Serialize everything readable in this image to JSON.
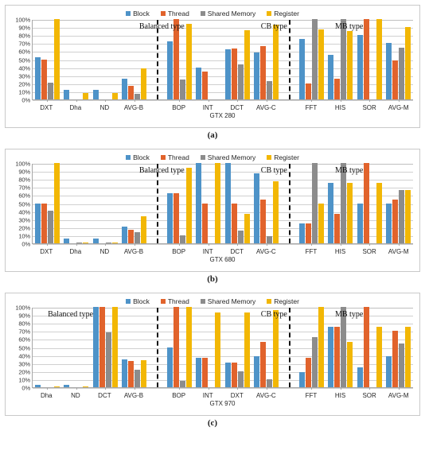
{
  "figure": {
    "panels": [
      {
        "caption": "(a)",
        "axis_title": "GTX 280",
        "zone_labels": [
          "Balanced type",
          "CB type",
          "MB type"
        ]
      },
      {
        "caption": "(b)",
        "axis_title": "GTX 680",
        "zone_labels": [
          "Balanced type",
          "CB type",
          "MB type"
        ]
      },
      {
        "caption": "(c)",
        "axis_title": "GTX 970",
        "zone_labels": [
          "Balanced type",
          "CB type",
          "MB type"
        ]
      }
    ],
    "legend": [
      {
        "label": "Block",
        "color": "#4E93C8"
      },
      {
        "label": "Thread",
        "color": "#E1632C"
      },
      {
        "label": "Shared Memory",
        "color": "#8C8C8C"
      },
      {
        "label": "Register",
        "color": "#F2B705"
      }
    ],
    "y_ticks": [
      "100%",
      "90%",
      "80%",
      "70%",
      "60%",
      "50%",
      "40%",
      "30%",
      "20%",
      "10%",
      "0%"
    ]
  },
  "chart_data": [
    {
      "type": "bar",
      "title": "GTX 280",
      "xlabel": "GTX 280",
      "ylabel": "",
      "ylim": [
        0,
        100
      ],
      "grid": true,
      "legend_position": "top-center",
      "annotations": [
        "Balanced type",
        "CB type",
        "MB type"
      ],
      "categories": [
        "DXT",
        "Dha",
        "ND",
        "AVG-B",
        "BOP",
        "INT",
        "DCT",
        "AVG-C",
        "FFT",
        "HIS",
        "SOR",
        "AVG-M"
      ],
      "series": [
        {
          "name": "Block",
          "values": [
            52,
            12,
            12,
            26,
            72,
            40,
            62,
            58,
            75,
            55,
            80,
            70
          ]
        },
        {
          "name": "Thread",
          "values": [
            50,
            0,
            0,
            17,
            100,
            35,
            63,
            66,
            20,
            26,
            100,
            49
          ]
        },
        {
          "name": "Shared Memory",
          "values": [
            21,
            0,
            0,
            7,
            25,
            0,
            44,
            23,
            100,
            100,
            0,
            64
          ]
        },
        {
          "name": "Register",
          "values": [
            100,
            8,
            8,
            39,
            94,
            0,
            86,
            93,
            87,
            85,
            100,
            90
          ]
        }
      ]
    },
    {
      "type": "bar",
      "title": "GTX 680",
      "xlabel": "GTX 680",
      "ylabel": "",
      "ylim": [
        0,
        100
      ],
      "grid": true,
      "legend_position": "top-center",
      "annotations": [
        "Balanced type",
        "CB type",
        "MB type"
      ],
      "categories": [
        "DXT",
        "Dha",
        "ND",
        "AVG-B",
        "BOP",
        "INT",
        "DCT",
        "AVG-C",
        "FFT",
        "HIS",
        "SOR",
        "AVG-M"
      ],
      "series": [
        {
          "name": "Block",
          "values": [
            50,
            6,
            6,
            21,
            62,
            100,
            100,
            87,
            25,
            75,
            50,
            50
          ]
        },
        {
          "name": "Thread",
          "values": [
            50,
            0,
            0,
            17,
            62,
            50,
            50,
            54,
            25,
            37,
            100,
            54
          ]
        },
        {
          "name": "Shared Memory",
          "values": [
            41,
            1,
            1,
            14,
            10,
            0,
            16,
            9,
            100,
            100,
            0,
            66
          ]
        },
        {
          "name": "Register",
          "values": [
            100,
            1,
            1,
            34,
            94,
            100,
            37,
            77,
            50,
            75,
            75,
            66
          ]
        }
      ]
    },
    {
      "type": "bar",
      "title": "GTX 970",
      "xlabel": "GTX 970",
      "ylabel": "",
      "ylim": [
        0,
        100
      ],
      "grid": true,
      "legend_position": "top-center",
      "annotations": [
        "Balanced type",
        "CB type",
        "MB type"
      ],
      "categories": [
        "Dha",
        "ND",
        "DCT",
        "AVG-B",
        "BOP",
        "INT",
        "DXT",
        "AVG-C",
        "FFT",
        "HIS",
        "SOR",
        "AVG-M"
      ],
      "series": [
        {
          "name": "Block",
          "values": [
            3,
            3,
            100,
            35,
            50,
            37,
            31,
            39,
            19,
            75,
            25,
            39
          ]
        },
        {
          "name": "Thread",
          "values": [
            0,
            0,
            100,
            33,
            100,
            37,
            31,
            56,
            37,
            75,
            100,
            70
          ]
        },
        {
          "name": "Shared Memory",
          "values": [
            0,
            0,
            68,
            22,
            8,
            0,
            20,
            10,
            62,
            100,
            0,
            54
          ]
        },
        {
          "name": "Register",
          "values": [
            1,
            1,
            100,
            34,
            100,
            93,
            93,
            96,
            100,
            56,
            75,
            75
          ]
        }
      ]
    }
  ]
}
